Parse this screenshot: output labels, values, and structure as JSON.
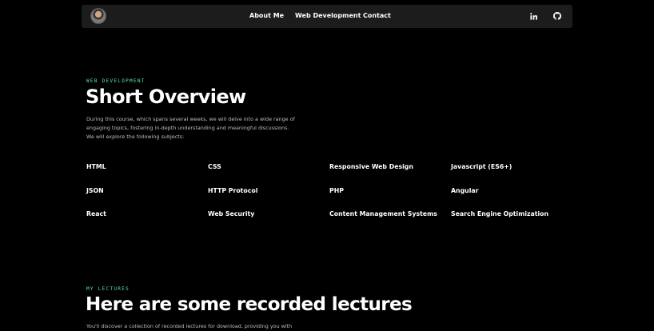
{
  "nav": {
    "links": [
      "About Me",
      "Web Development",
      "Contact"
    ],
    "icons": [
      "linkedin-icon",
      "github-icon"
    ]
  },
  "overview": {
    "eyebrow": "WEB DEVELOPMENT",
    "title": "Short Overview",
    "description_lines": [
      "During this course, which spans several weeks, we will delve into a wide range of",
      "engaging topics, fostering in-depth understanding and meaningful discussions.",
      "We will explore the following subjects:"
    ],
    "topics": [
      [
        "HTML",
        "CSS",
        "Responsive Web Design",
        "Javascript (ES6+)"
      ],
      [
        "JSON",
        "HTTP Protocol",
        "PHP",
        "Angular"
      ],
      [
        "React",
        "Web Security",
        "Content Management Systems",
        "Search Engine Optimization"
      ]
    ]
  },
  "lectures": {
    "eyebrow": "MY LECTURES",
    "title": "Here are some recorded lectures",
    "description_lines": [
      "You'll discover a collection of recorded lectures for download, providing you with"
    ]
  },
  "colors": {
    "accent": "#5ee8a0",
    "background": "#000000",
    "navbar": "#1c1c1c"
  }
}
